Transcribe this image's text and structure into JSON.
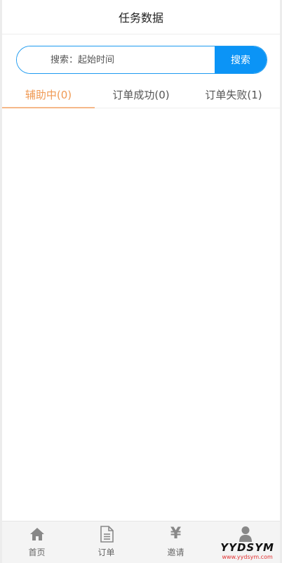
{
  "header": {
    "title": "任务数据"
  },
  "search": {
    "placeholder": "搜索：起始时间",
    "button_label": "搜索"
  },
  "tabs": [
    {
      "label": "辅助中(0)",
      "active": true
    },
    {
      "label": "订单成功(0)",
      "active": false
    },
    {
      "label": "订单失败(1)",
      "active": false
    }
  ],
  "tabbar": [
    {
      "label": "首页",
      "icon": "home-icon"
    },
    {
      "label": "订单",
      "icon": "document-icon"
    },
    {
      "label": "邀请",
      "icon": "yen-icon",
      "glyph": "¥"
    },
    {
      "label": "",
      "icon": "user-icon"
    }
  ],
  "watermark": {
    "text": "YYDSYM",
    "url": "www.yydsym.com"
  },
  "colors": {
    "accent": "#0b94f6",
    "active_tab": "#f09a54",
    "icon_gray": "#888888"
  }
}
